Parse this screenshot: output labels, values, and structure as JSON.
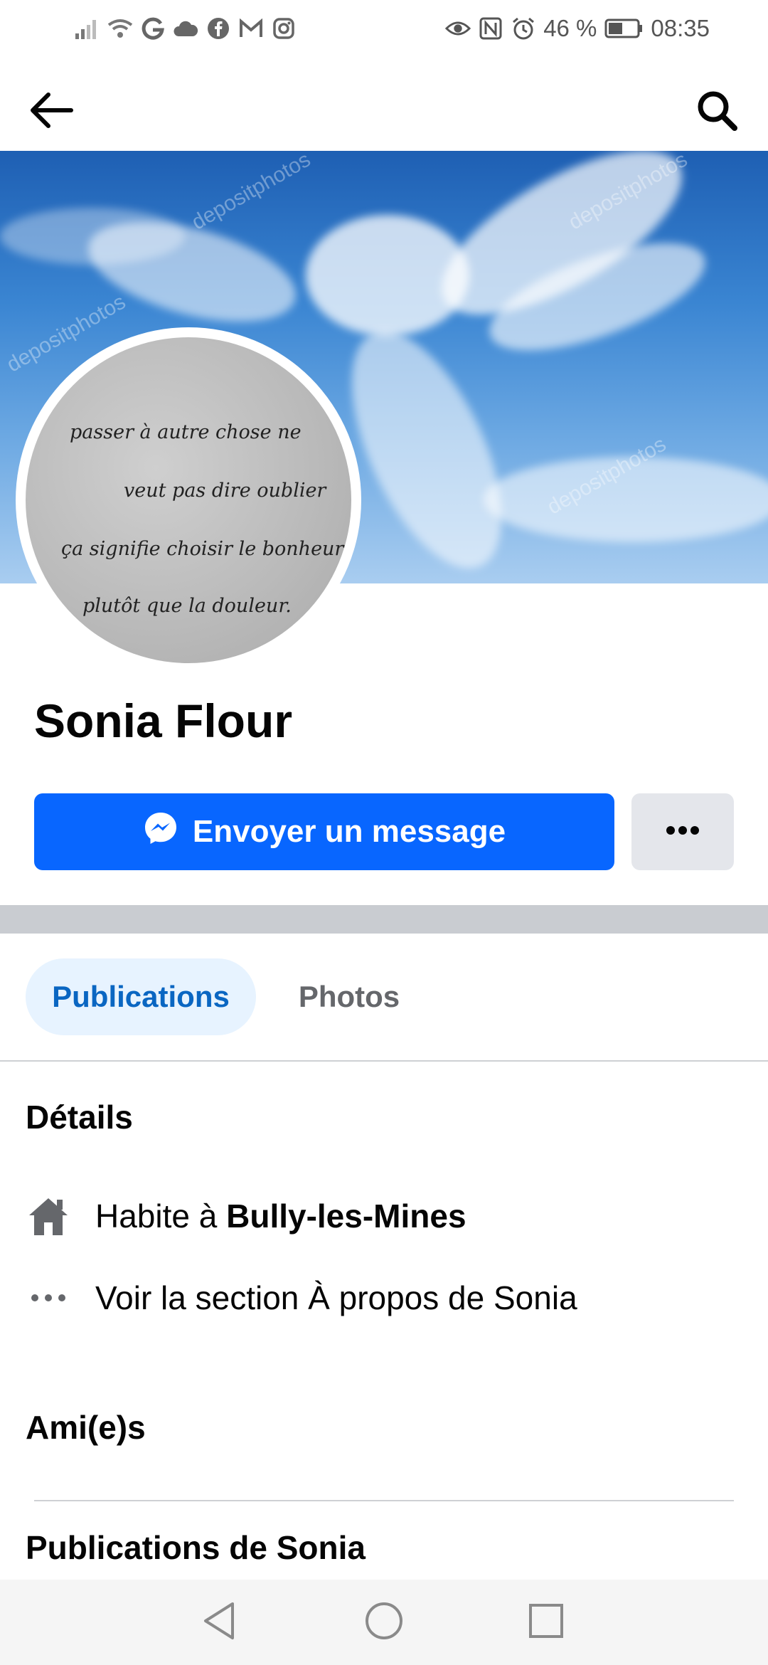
{
  "status_bar": {
    "battery_percent": "46 %",
    "time": "08:35",
    "left_icons": [
      "signal-icon",
      "wifi-icon",
      "google-icon",
      "cloud-icon",
      "facebook-icon",
      "gmail-icon",
      "instagram-icon"
    ],
    "right_icons": [
      "eye-icon",
      "nfc-icon",
      "alarm-icon",
      "battery-icon"
    ]
  },
  "header": {
    "back_icon": "arrow-left-icon",
    "search_icon": "search-icon"
  },
  "cover": {
    "watermark": "depositphotos"
  },
  "profile": {
    "avatar_text": [
      "passer à autre chose ne",
      "veut pas dire oublier",
      "ça signifie choisir le bonheur",
      "plutôt que la douleur."
    ],
    "name": "Sonia Flour"
  },
  "actions": {
    "message_label": "Envoyer un message",
    "message_icon": "messenger-icon",
    "more_icon": "more-horizontal-icon"
  },
  "tabs": [
    {
      "label": "Publications",
      "active": true
    },
    {
      "label": "Photos",
      "active": false
    }
  ],
  "details": {
    "title": "Détails",
    "lives_prefix": "Habite à ",
    "lives_city": "Bully-les-Mines",
    "about_link": "Voir la section À propos de Sonia"
  },
  "friends": {
    "title": "Ami(e)s"
  },
  "posts": {
    "title": "Publications de Sonia"
  },
  "nav": {
    "back_icon": "nav-back-icon",
    "home_icon": "nav-home-icon",
    "recents_icon": "nav-recents-icon"
  },
  "colors": {
    "accent": "#0866ff",
    "tab_active_bg": "#e7f3ff",
    "tab_active_text": "#0a66c2"
  }
}
